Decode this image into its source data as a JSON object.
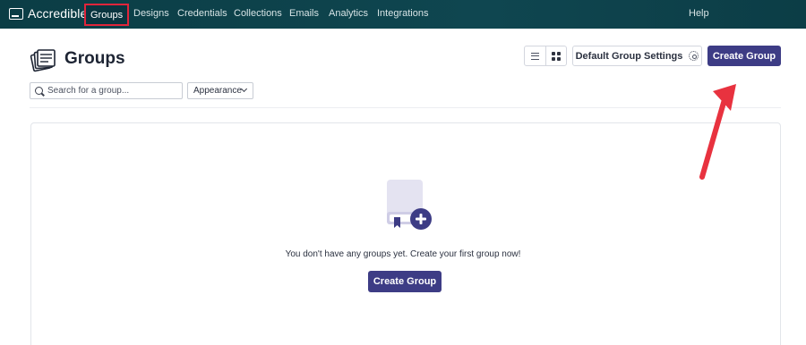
{
  "nav": {
    "brand": "Accredible",
    "items": [
      "Groups",
      "Designs",
      "Credentials",
      "Collections",
      "Emails",
      "Analytics",
      "Integrations"
    ],
    "help": "Help"
  },
  "header": {
    "title": "Groups",
    "default_settings_label": "Default Group Settings",
    "create_label": "Create Group"
  },
  "filters": {
    "search_placeholder": "Search for a group...",
    "appearance_label": "Appearance"
  },
  "empty_state": {
    "message": "You don't have any groups yet. Create your first group now!",
    "create_label": "Create Group"
  },
  "colors": {
    "nav_bg": "#0f4650",
    "primary": "#3d3c85",
    "highlight": "#e0253b",
    "arrow": "#e8323f"
  }
}
